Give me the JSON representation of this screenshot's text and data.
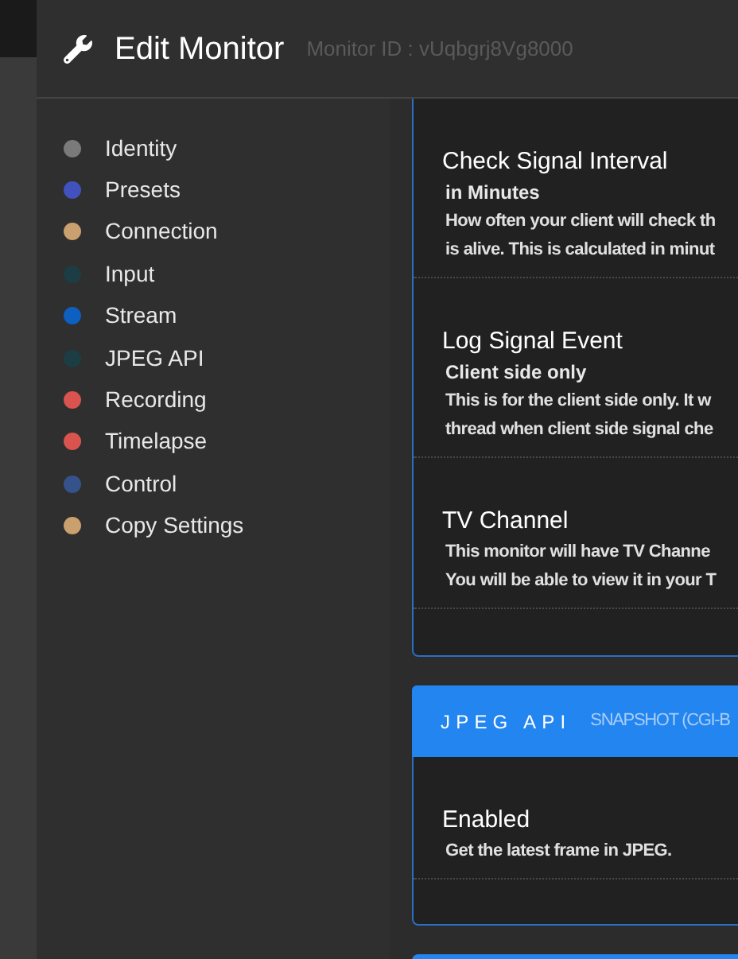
{
  "header": {
    "title": "Edit Monitor",
    "monitor_id": "Monitor ID : vUqbgrj8Vg8000"
  },
  "sidebar": {
    "items": [
      {
        "label": "Identity",
        "color": "#7a7a7a"
      },
      {
        "label": "Presets",
        "color": "#4152bd"
      },
      {
        "label": "Connection",
        "color": "#c9a06e"
      },
      {
        "label": "Input",
        "color": "#1d3d45"
      },
      {
        "label": "Stream",
        "color": "#0d5fc0"
      },
      {
        "label": "JPEG API",
        "color": "#1d3d45"
      },
      {
        "label": "Recording",
        "color": "#d9534f"
      },
      {
        "label": "Timelapse",
        "color": "#d9534f"
      },
      {
        "label": "Control",
        "color": "#35528a"
      },
      {
        "label": "Copy Settings",
        "color": "#c9a06e"
      }
    ]
  },
  "sections": [
    {
      "settings": [
        {
          "title": "Check Signal Interval",
          "subtitle": "in Minutes",
          "description": [
            "How often your client will check th",
            "is alive. This is calculated in minut"
          ]
        },
        {
          "title": "Log Signal Event",
          "subtitle": "Client side only",
          "description": [
            "This is for the client side only. It w",
            "thread when client side signal che"
          ]
        },
        {
          "title": "TV Channel",
          "description": [
            "This monitor will have TV Channe",
            "You will be able to view it in your T"
          ]
        }
      ]
    },
    {
      "heading": "JPEG API",
      "subheading": "SNAPSHOT (CGI-B",
      "settings": [
        {
          "title": "Enabled",
          "description": [
            "Get the latest frame in JPEG."
          ]
        }
      ]
    }
  ]
}
